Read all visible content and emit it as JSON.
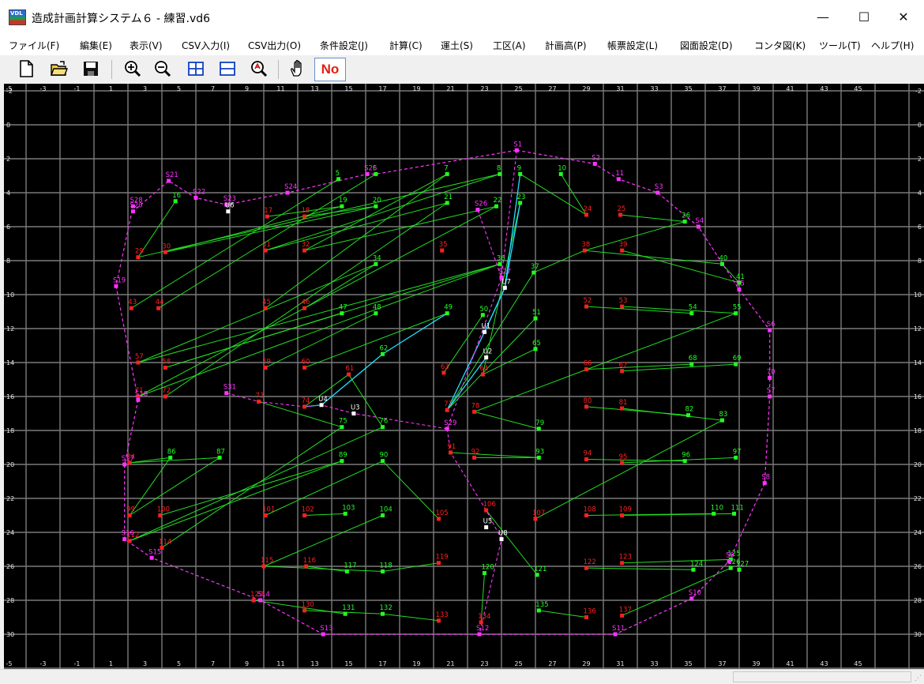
{
  "window": {
    "title": "造成計画計算システム６ - 練習.vd6",
    "app_icon_text": "VDL",
    "minimize": "—",
    "maximize": "☐",
    "close": "✕"
  },
  "menu": [
    "ファイル(F)",
    "編集(E)",
    "表示(V)",
    "CSV入力(I)",
    "CSV出力(O)",
    "条件設定(J)",
    "計算(C)",
    "運土(S)",
    "工区(A)",
    "計画高(P)",
    "帳票設定(L)",
    "図面設定(D)",
    "コンタ図(K)",
    "ツール(T)",
    "ヘルプ(H)"
  ],
  "toolbar": {
    "icons": [
      "new-file-icon",
      "open-folder-icon",
      "save-icon",
      "zoom-in-icon",
      "zoom-out-icon",
      "fit-horizontal-icon",
      "fit-vertical-icon",
      "zoom-all-icon",
      "pan-hand-icon"
    ],
    "no_label": "No"
  },
  "grid": {
    "x_labels": [
      "-5",
      "-3",
      "-1",
      "1",
      "3",
      "5",
      "7",
      "9",
      "11",
      "13",
      "15",
      "17",
      "19",
      "21",
      "23",
      "25",
      "27",
      "29",
      "31",
      "33",
      "35",
      "37",
      "39",
      "41",
      "43",
      "45"
    ],
    "y_labels": [
      "-2",
      "0",
      "2",
      "4",
      "6",
      "8",
      "10",
      "12",
      "14",
      "16",
      "18",
      "20",
      "22",
      "24",
      "26",
      "28",
      "30"
    ],
    "colors": {
      "background": "#000000",
      "grid": "#7a7a7a",
      "point_red": "#ff2020",
      "point_green": "#22ff22",
      "boundary": "#ff33ff",
      "user": "#ffffff",
      "line_green": "#22dd22",
      "line_cyan": "#22ddff"
    }
  },
  "points_red": [
    {
      "n": "17",
      "x": 10.2,
      "y": 5.4
    },
    {
      "n": "18",
      "x": 12.4,
      "y": 5.4
    },
    {
      "n": "24",
      "x": 29.0,
      "y": 5.3
    },
    {
      "n": "25",
      "x": 31.0,
      "y": 5.3
    },
    {
      "n": "29",
      "x": 2.6,
      "y": 7.8
    },
    {
      "n": "30",
      "x": 4.2,
      "y": 7.5
    },
    {
      "n": "31",
      "x": 10.1,
      "y": 7.4
    },
    {
      "n": "32",
      "x": 12.4,
      "y": 7.4
    },
    {
      "n": "35",
      "x": 20.5,
      "y": 7.4
    },
    {
      "n": "38",
      "x": 28.9,
      "y": 7.4
    },
    {
      "n": "39",
      "x": 31.1,
      "y": 7.4
    },
    {
      "n": "43",
      "x": 2.2,
      "y": 10.8
    },
    {
      "n": "44",
      "x": 3.8,
      "y": 10.8
    },
    {
      "n": "45",
      "x": 10.1,
      "y": 10.8
    },
    {
      "n": "46",
      "x": 12.4,
      "y": 10.8
    },
    {
      "n": "52",
      "x": 29.0,
      "y": 10.7
    },
    {
      "n": "53",
      "x": 31.1,
      "y": 10.7
    },
    {
      "n": "57",
      "x": 2.6,
      "y": 14.0
    },
    {
      "n": "58",
      "x": 4.2,
      "y": 14.3
    },
    {
      "n": "59",
      "x": 10.1,
      "y": 14.3
    },
    {
      "n": "60",
      "x": 12.4,
      "y": 14.3
    },
    {
      "n": "61",
      "x": 15.0,
      "y": 14.7
    },
    {
      "n": "63",
      "x": 20.6,
      "y": 14.6
    },
    {
      "n": "64",
      "x": 22.9,
      "y": 14.7
    },
    {
      "n": "66",
      "x": 29.0,
      "y": 14.4
    },
    {
      "n": "67",
      "x": 31.1,
      "y": 14.5
    },
    {
      "n": "71",
      "x": 2.6,
      "y": 16.0
    },
    {
      "n": "72",
      "x": 4.2,
      "y": 16.0
    },
    {
      "n": "73",
      "x": 9.7,
      "y": 16.3
    },
    {
      "n": "74",
      "x": 12.4,
      "y": 16.6
    },
    {
      "n": "77",
      "x": 20.8,
      "y": 16.8
    },
    {
      "n": "78",
      "x": 22.4,
      "y": 16.9
    },
    {
      "n": "80",
      "x": 29.0,
      "y": 16.6
    },
    {
      "n": "81",
      "x": 31.1,
      "y": 16.7
    },
    {
      "n": "84",
      "x": 2.1,
      "y": 19.9
    },
    {
      "n": "91",
      "x": 21.0,
      "y": 19.3
    },
    {
      "n": "92",
      "x": 22.4,
      "y": 19.6
    },
    {
      "n": "94",
      "x": 29.0,
      "y": 19.7
    },
    {
      "n": "95",
      "x": 31.1,
      "y": 19.9
    },
    {
      "n": "99",
      "x": 2.1,
      "y": 23.0
    },
    {
      "n": "100",
      "x": 3.9,
      "y": 23.0
    },
    {
      "n": "101",
      "x": 10.1,
      "y": 23.0
    },
    {
      "n": "102",
      "x": 12.4,
      "y": 23.0
    },
    {
      "n": "105",
      "x": 20.3,
      "y": 23.2
    },
    {
      "n": "106",
      "x": 23.1,
      "y": 22.7
    },
    {
      "n": "107",
      "x": 26.0,
      "y": 23.2
    },
    {
      "n": "108",
      "x": 29.0,
      "y": 23.0
    },
    {
      "n": "109",
      "x": 31.1,
      "y": 23.0
    },
    {
      "n": "112",
      "x": 2.1,
      "y": 24.5
    },
    {
      "n": "114",
      "x": 4.0,
      "y": 24.9
    },
    {
      "n": "115",
      "x": 10.0,
      "y": 26.0
    },
    {
      "n": "116",
      "x": 12.5,
      "y": 26.0
    },
    {
      "n": "119",
      "x": 20.3,
      "y": 25.8
    },
    {
      "n": "122",
      "x": 29.0,
      "y": 26.1
    },
    {
      "n": "123",
      "x": 31.1,
      "y": 25.8
    },
    {
      "n": "129",
      "x": 9.4,
      "y": 28.0
    },
    {
      "n": "130",
      "x": 12.4,
      "y": 28.6
    },
    {
      "n": "133",
      "x": 20.3,
      "y": 29.2
    },
    {
      "n": "134",
      "x": 22.8,
      "y": 29.3
    },
    {
      "n": "136",
      "x": 29.0,
      "y": 29.0
    },
    {
      "n": "137",
      "x": 31.1,
      "y": 28.9
    }
  ],
  "points_green": [
    {
      "n": "5",
      "x": 14.4,
      "y": 3.2
    },
    {
      "n": "6",
      "x": 16.6,
      "y": 2.9
    },
    {
      "n": "7",
      "x": 20.8,
      "y": 2.9
    },
    {
      "n": "8",
      "x": 23.9,
      "y": 2.9
    },
    {
      "n": "9",
      "x": 25.1,
      "y": 2.9
    },
    {
      "n": "10",
      "x": 27.5,
      "y": 2.9
    },
    {
      "n": "16",
      "x": 4.8,
      "y": 4.5
    },
    {
      "n": "19",
      "x": 14.6,
      "y": 4.8
    },
    {
      "n": "20",
      "x": 16.6,
      "y": 4.8
    },
    {
      "n": "21",
      "x": 20.8,
      "y": 4.6
    },
    {
      "n": "22",
      "x": 23.7,
      "y": 4.8
    },
    {
      "n": "23",
      "x": 25.1,
      "y": 4.6
    },
    {
      "n": "26",
      "x": 34.8,
      "y": 5.7
    },
    {
      "n": "34",
      "x": 16.6,
      "y": 8.2
    },
    {
      "n": "36",
      "x": 23.9,
      "y": 8.2
    },
    {
      "n": "37",
      "x": 25.9,
      "y": 8.7
    },
    {
      "n": "40",
      "x": 37.0,
      "y": 8.2
    },
    {
      "n": "41",
      "x": 38.0,
      "y": 9.3
    },
    {
      "n": "47",
      "x": 14.6,
      "y": 11.1
    },
    {
      "n": "48",
      "x": 16.6,
      "y": 11.1
    },
    {
      "n": "49",
      "x": 20.8,
      "y": 11.1
    },
    {
      "n": "50",
      "x": 22.9,
      "y": 11.2
    },
    {
      "n": "51",
      "x": 26.0,
      "y": 11.4
    },
    {
      "n": "54",
      "x": 35.2,
      "y": 11.1
    },
    {
      "n": "55",
      "x": 37.8,
      "y": 11.1
    },
    {
      "n": "62",
      "x": 17.0,
      "y": 13.5
    },
    {
      "n": "65",
      "x": 26.0,
      "y": 13.2
    },
    {
      "n": "68",
      "x": 35.2,
      "y": 14.1
    },
    {
      "n": "69",
      "x": 37.8,
      "y": 14.1
    },
    {
      "n": "75",
      "x": 14.6,
      "y": 17.8
    },
    {
      "n": "76",
      "x": 17.0,
      "y": 17.8
    },
    {
      "n": "79",
      "x": 26.2,
      "y": 17.9
    },
    {
      "n": "82",
      "x": 35.0,
      "y": 17.1
    },
    {
      "n": "83",
      "x": 37.0,
      "y": 17.4
    },
    {
      "n": "86",
      "x": 4.5,
      "y": 19.6
    },
    {
      "n": "87",
      "x": 7.4,
      "y": 19.6
    },
    {
      "n": "89",
      "x": 14.6,
      "y": 19.8
    },
    {
      "n": "90",
      "x": 17.0,
      "y": 19.8
    },
    {
      "n": "93",
      "x": 26.2,
      "y": 19.6
    },
    {
      "n": "96",
      "x": 34.8,
      "y": 19.8
    },
    {
      "n": "97",
      "x": 37.8,
      "y": 19.6
    },
    {
      "n": "103",
      "x": 14.8,
      "y": 22.9
    },
    {
      "n": "104",
      "x": 17.0,
      "y": 23.0
    },
    {
      "n": "110",
      "x": 36.5,
      "y": 22.9
    },
    {
      "n": "111",
      "x": 37.7,
      "y": 22.9
    },
    {
      "n": "117",
      "x": 14.9,
      "y": 26.3
    },
    {
      "n": "118",
      "x": 17.0,
      "y": 26.3
    },
    {
      "n": "120",
      "x": 23.0,
      "y": 26.4
    },
    {
      "n": "121",
      "x": 26.1,
      "y": 26.5
    },
    {
      "n": "124",
      "x": 35.3,
      "y": 26.2
    },
    {
      "n": "125",
      "x": 37.5,
      "y": 25.6
    },
    {
      "n": "126",
      "x": 37.5,
      "y": 26.1
    },
    {
      "n": "127",
      "x": 38.0,
      "y": 26.2
    },
    {
      "n": "131",
      "x": 14.8,
      "y": 28.8
    },
    {
      "n": "132",
      "x": 17.0,
      "y": 28.8
    },
    {
      "n": "135",
      "x": 26.2,
      "y": 28.6
    }
  ],
  "boundary_points": [
    {
      "n": "S1",
      "x": 24.9,
      "y": 1.5
    },
    {
      "n": "S2",
      "x": 29.5,
      "y": 2.3
    },
    {
      "n": "11",
      "x": 30.9,
      "y": 3.2
    },
    {
      "n": "S3",
      "x": 33.2,
      "y": 4.0
    },
    {
      "n": "S4",
      "x": 35.6,
      "y": 6.0
    },
    {
      "n": "S5",
      "x": 38.0,
      "y": 9.7
    },
    {
      "n": "S6",
      "x": 39.8,
      "y": 12.1
    },
    {
      "n": "70",
      "x": 39.8,
      "y": 14.9
    },
    {
      "n": "S7",
      "x": 39.8,
      "y": 16.0
    },
    {
      "n": "S8",
      "x": 39.5,
      "y": 21.1
    },
    {
      "n": "S9",
      "x": 37.4,
      "y": 25.7
    },
    {
      "n": "S10",
      "x": 35.2,
      "y": 27.9
    },
    {
      "n": "S11",
      "x": 30.7,
      "y": 30.0
    },
    {
      "n": "S12",
      "x": 22.7,
      "y": 30.0
    },
    {
      "n": "S13",
      "x": 13.5,
      "y": 30.0
    },
    {
      "n": "S14",
      "x": 9.8,
      "y": 28.0
    },
    {
      "n": "S15",
      "x": 3.4,
      "y": 25.5
    },
    {
      "n": "S16",
      "x": 1.8,
      "y": 24.4
    },
    {
      "n": "S17",
      "x": 1.8,
      "y": 20.0
    },
    {
      "n": "S18",
      "x": 2.6,
      "y": 16.2
    },
    {
      "n": "S19",
      "x": 1.3,
      "y": 9.5
    },
    {
      "n": "S20",
      "x": 2.3,
      "y": 5.1
    },
    {
      "n": "S21",
      "x": 4.4,
      "y": 3.3
    },
    {
      "n": "S22",
      "x": 6.0,
      "y": 4.3
    },
    {
      "n": "S23",
      "x": 7.8,
      "y": 4.7
    },
    {
      "n": "S24",
      "x": 11.4,
      "y": 4.0
    },
    {
      "n": "S25",
      "x": 16.1,
      "y": 2.9
    },
    {
      "n": "S26",
      "x": 22.6,
      "y": 5.0
    },
    {
      "n": "S27",
      "x": 24.0,
      "y": 9.0
    },
    {
      "n": "S28",
      "x": 2.3,
      "y": 4.8
    },
    {
      "n": "S29",
      "x": 20.8,
      "y": 17.9
    },
    {
      "n": "S31",
      "x": 7.8,
      "y": 15.8
    }
  ],
  "user_points": [
    {
      "n": "U1",
      "x": 23.0,
      "y": 12.2
    },
    {
      "n": "U2",
      "x": 23.1,
      "y": 13.7
    },
    {
      "n": "U3",
      "x": 15.3,
      "y": 17.0
    },
    {
      "n": "U4",
      "x": 13.4,
      "y": 16.5
    },
    {
      "n": "U5",
      "x": 23.1,
      "y": 23.7
    },
    {
      "n": "U6",
      "x": 7.9,
      "y": 5.1
    },
    {
      "n": "U7",
      "x": 24.2,
      "y": 9.6
    },
    {
      "n": "U8",
      "x": 24.0,
      "y": 24.4
    }
  ],
  "status": ""
}
